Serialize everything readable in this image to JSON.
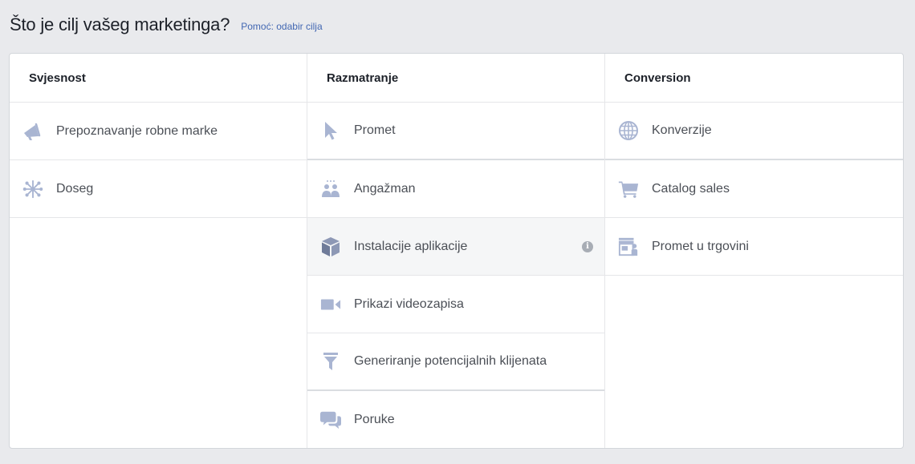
{
  "header": {
    "title": "Što je cilj vašeg marketinga?",
    "help_link": "Pomoć: odabir cilja"
  },
  "columns": [
    {
      "title": "Svjesnost",
      "items": [
        {
          "label": "Prepoznavanje robne marke",
          "icon": "megaphone-icon"
        },
        {
          "label": "Doseg",
          "icon": "reach-icon"
        }
      ]
    },
    {
      "title": "Razmatranje",
      "items": [
        {
          "label": "Promet",
          "icon": "cursor-icon"
        },
        {
          "label": "Angažman",
          "icon": "people-icon"
        },
        {
          "label": "Instalacije aplikacije",
          "icon": "box-icon",
          "info_icon": "info-icon"
        },
        {
          "label": "Prikazi videozapisa",
          "icon": "video-camera-icon"
        },
        {
          "label": "Generiranje potencijalnih klijenata",
          "icon": "funnel-icon"
        },
        {
          "label": "Poruke",
          "icon": "chat-bubbles-icon"
        }
      ]
    },
    {
      "title": "Conversion",
      "items": [
        {
          "label": "Konverzije",
          "icon": "globe-icon"
        },
        {
          "label": "Catalog sales",
          "icon": "cart-icon"
        },
        {
          "label": "Promet u trgovini",
          "icon": "store-icon"
        }
      ]
    }
  ],
  "colors": {
    "page_background": "#e9eaed",
    "panel_background": "#ffffff",
    "icon_color": "#a9b5d2",
    "link_color": "#4267b2",
    "hover_row": "#f5f6f7"
  }
}
